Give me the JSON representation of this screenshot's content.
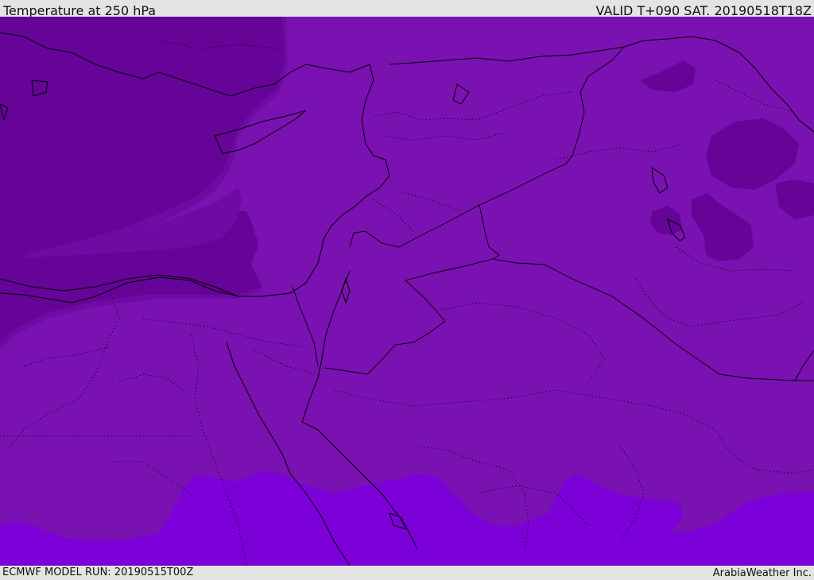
{
  "header": {
    "title": "Temperature at 250 hPa",
    "valid": "VALID T+090 SAT. 20190518T18Z"
  },
  "footer": {
    "model_run": "ECMWF MODEL RUN: 20190515T00Z",
    "credit": "ArabiaWeather Inc."
  },
  "map": {
    "field": "temperature",
    "level": "250 hPa",
    "region": "Eastern Mediterranean and Middle East",
    "colors": {
      "coldest": "#650497",
      "cold": "#6e0ba2",
      "mid": "#7a12b2",
      "warm": "#7c00d8",
      "coastline": "#000000",
      "border": "#000000"
    }
  }
}
